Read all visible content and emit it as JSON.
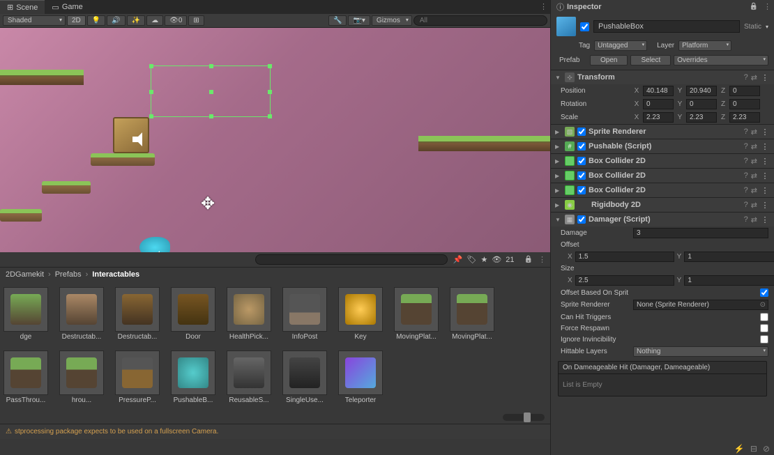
{
  "tabs": {
    "scene": "Scene",
    "game": "Game",
    "inspector": "Inspector"
  },
  "toolbar": {
    "shading": "Shaded",
    "mode2d": "2D",
    "gizmos": "Gizmos",
    "search_placeholder": "All",
    "viz_count": "21"
  },
  "breadcrumb": [
    "2DGamekit",
    "Prefabs",
    "Interactables"
  ],
  "assets": [
    {
      "name": "dge"
    },
    {
      "name": "Destructab..."
    },
    {
      "name": "Destructab..."
    },
    {
      "name": "Door"
    },
    {
      "name": "HealthPick..."
    },
    {
      "name": "InfoPost"
    },
    {
      "name": "Key"
    },
    {
      "name": "MovingPlat..."
    },
    {
      "name": "MovingPlat..."
    },
    {
      "name": "PassThrou..."
    },
    {
      "name": "hrou..."
    },
    {
      "name": "PressureP..."
    },
    {
      "name": "PushableB..."
    },
    {
      "name": "ReusableS..."
    },
    {
      "name": "SingleUse..."
    },
    {
      "name": "Teleporter"
    }
  ],
  "object": {
    "name": "PushableBox",
    "static_label": "Static",
    "tag_label": "Tag",
    "tag_value": "Untagged",
    "layer_label": "Layer",
    "layer_value": "Platform",
    "prefab_label": "Prefab",
    "open": "Open",
    "select": "Select",
    "overrides": "Overrides"
  },
  "transform": {
    "title": "Transform",
    "position_label": "Position",
    "pos_x": "40.148",
    "pos_y": "20.940",
    "pos_z": "0",
    "rotation_label": "Rotation",
    "rot_x": "0",
    "rot_y": "0",
    "rot_z": "0",
    "scale_label": "Scale",
    "scl_x": "2.23",
    "scl_y": "2.23",
    "scl_z": "2.23"
  },
  "components": {
    "sprite_renderer": "Sprite Renderer",
    "pushable": "Pushable (Script)",
    "box_collider": "Box Collider 2D",
    "rigidbody": "Rigidbody 2D",
    "damager": "Damager (Script)"
  },
  "damager": {
    "damage_label": "Damage",
    "damage_value": "3",
    "offset_label": "Offset",
    "offset_x": "1.5",
    "offset_y": "1",
    "size_label": "Size",
    "size_x": "2.5",
    "size_y": "1",
    "offset_sprite_label": "Offset Based On Sprit",
    "sprite_renderer_label": "Sprite Renderer",
    "sprite_renderer_value": "None (Sprite Renderer)",
    "can_hit_label": "Can Hit Triggers",
    "force_respawn_label": "Force Respawn",
    "ignore_inv_label": "Ignore Invincibility",
    "hittable_label": "Hittable Layers",
    "hittable_value": "Nothing",
    "event_title": "On Dameageable Hit (Damager, Dameageable)",
    "event_empty": "List is Empty"
  },
  "status": "stprocessing package expects to be used on a fullscreen Camera."
}
